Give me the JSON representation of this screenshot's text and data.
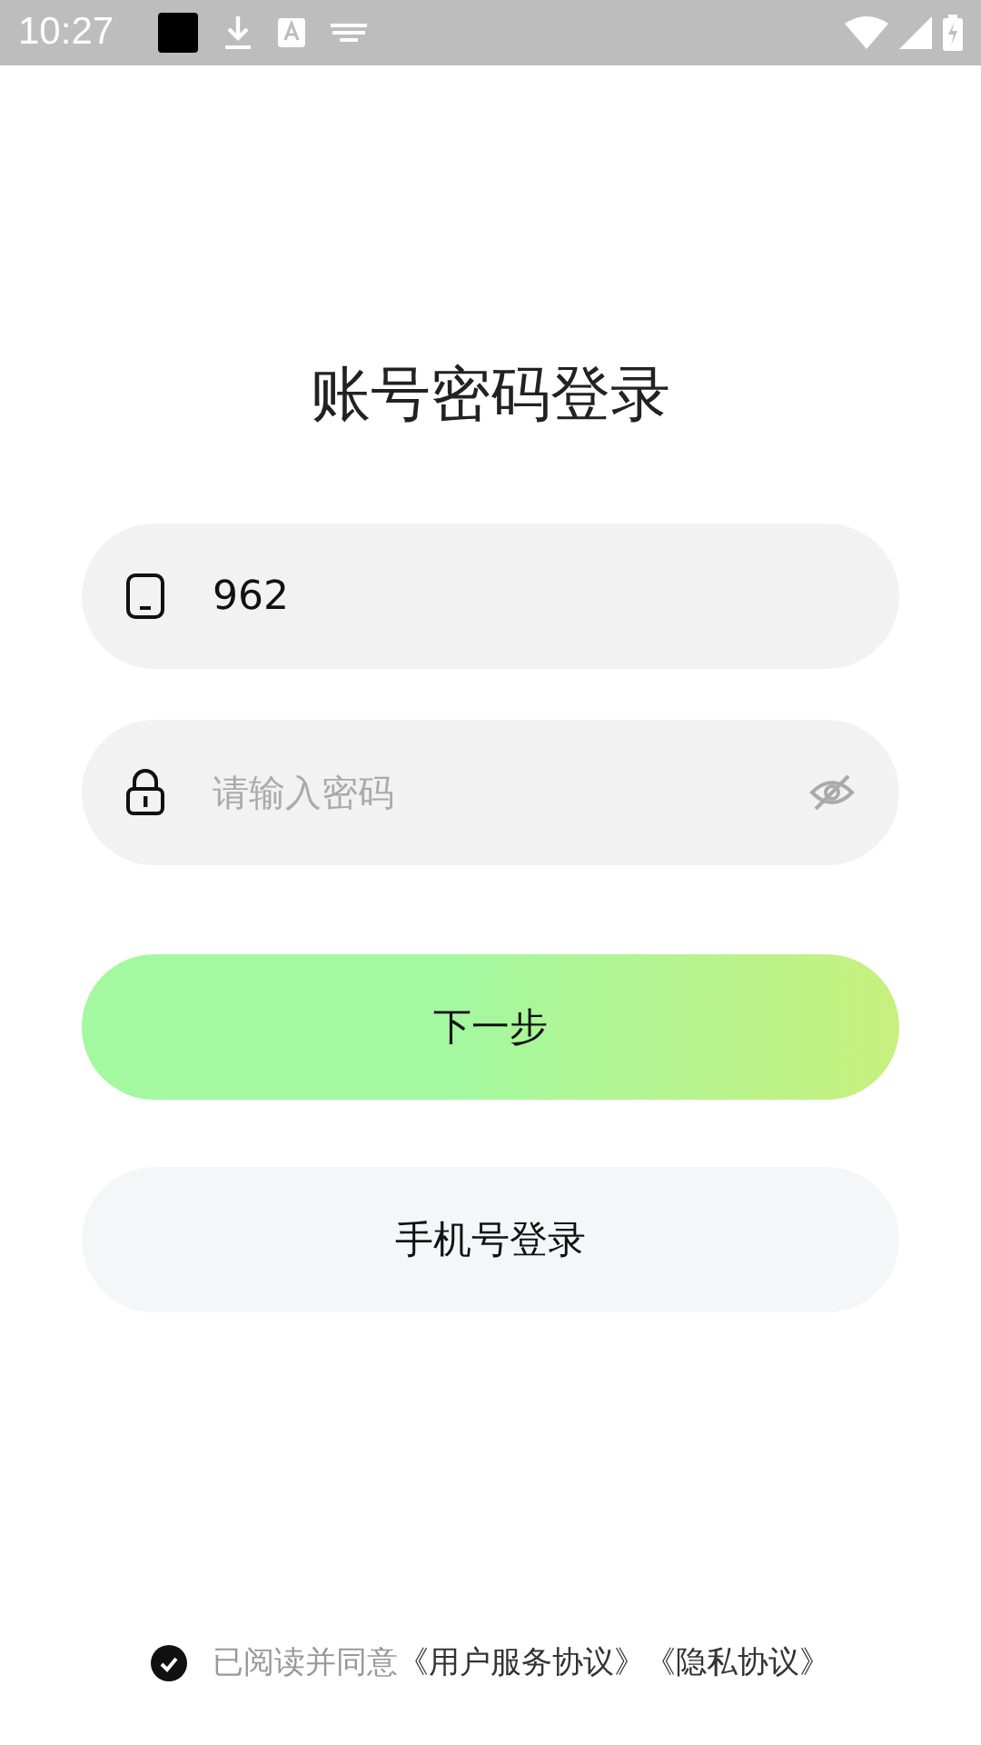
{
  "status_bar": {
    "time": "10:27"
  },
  "title": "账号密码登录",
  "account_field": {
    "value": "962"
  },
  "password_field": {
    "placeholder": "请输入密码",
    "visible": false
  },
  "buttons": [
    {
      "label": "下一步",
      "kind": "primary"
    },
    {
      "label": "手机号登录",
      "kind": "secondary"
    }
  ],
  "agreement": {
    "checked": true,
    "text": "已阅读并同意",
    "links": [
      "《用户服务协议》",
      "《隐私协议》"
    ]
  }
}
